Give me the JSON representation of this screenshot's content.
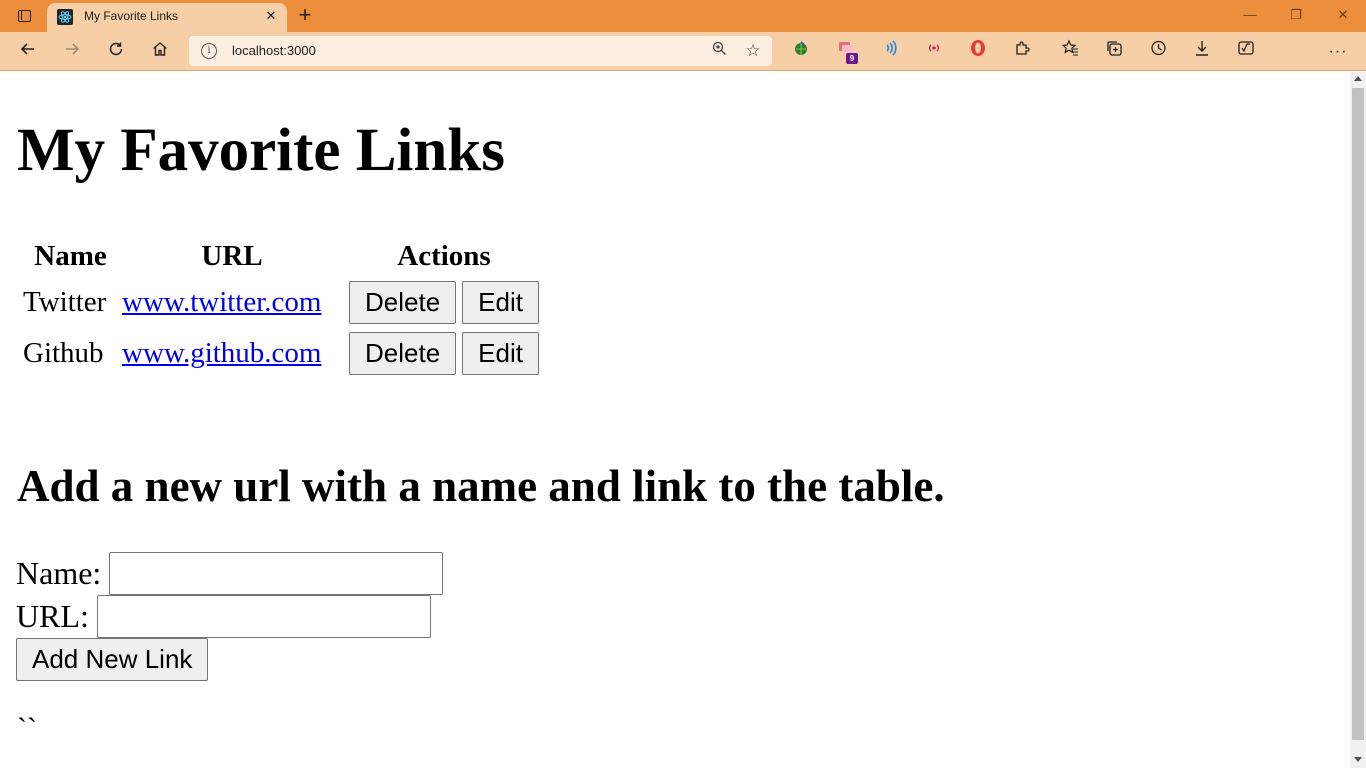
{
  "browser": {
    "tab_title": "My Favorite Links",
    "tab_close": "✕",
    "new_tab": "+",
    "address": "localhost:3000",
    "window_controls": {
      "minimize": "—",
      "maximize": "❐",
      "close": "✕"
    },
    "toolbar_icons": [
      "extension-globe-icon",
      "extension-translate-icon",
      "extension-audio-icon",
      "extension-broadcast-icon",
      "extension-opera-icon",
      "extensions-icon",
      "favorites-icon",
      "collections-icon",
      "history-icon",
      "downloads-icon",
      "math-solver-icon",
      "profile-avatar",
      "settings-more-icon"
    ],
    "badge_count": "9",
    "accent_color": "#ec8e3c"
  },
  "page": {
    "title": "My Favorite Links",
    "table": {
      "headers": [
        "Name",
        "URL",
        "Actions"
      ],
      "rows": [
        {
          "name": "Twitter",
          "url": "www.twitter.com",
          "delete": "Delete",
          "edit": "Edit"
        },
        {
          "name": "Github",
          "url": "www.github.com",
          "delete": "Delete",
          "edit": "Edit"
        }
      ]
    },
    "form_heading": "Add a new url with a name and link to the table.",
    "form": {
      "name_label": "Name:",
      "name_value": "",
      "url_label": "URL:",
      "url_value": "",
      "submit": "Add New Link"
    },
    "trailing_text": "``"
  }
}
